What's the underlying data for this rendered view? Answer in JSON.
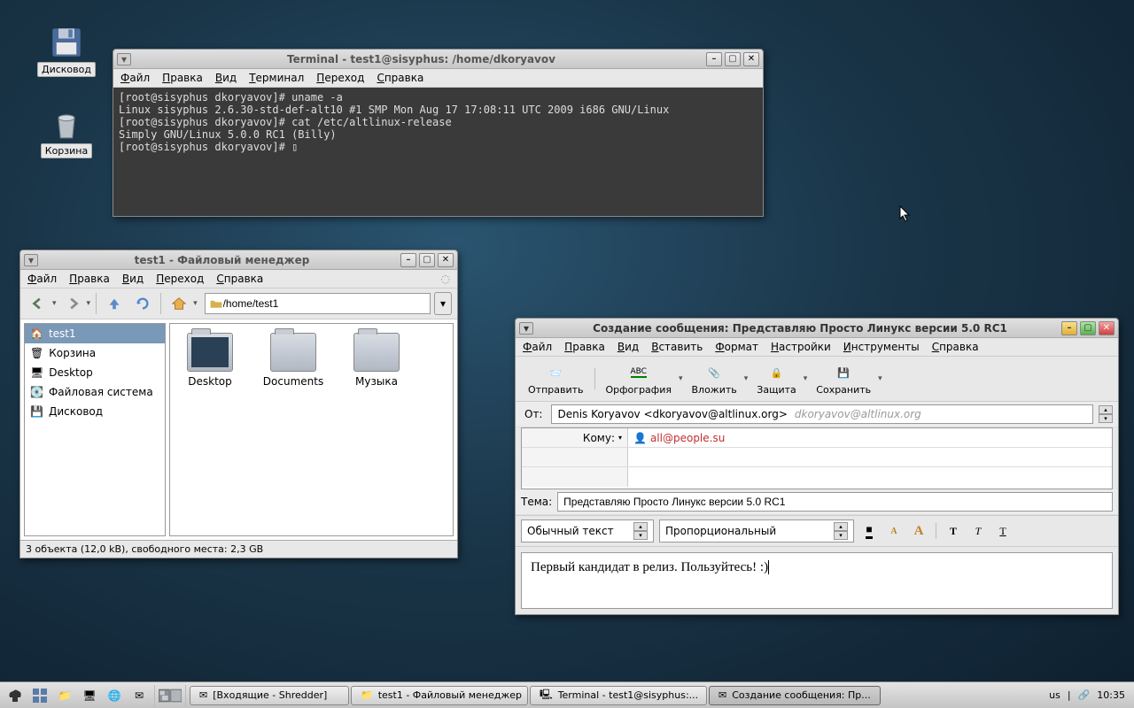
{
  "desktop": {
    "icons": [
      {
        "name": "floppy-icon",
        "label": "Дисковод"
      },
      {
        "name": "trash-icon",
        "label": "Корзина"
      }
    ]
  },
  "terminal": {
    "title": "Terminal - test1@sisyphus: /home/dkoryavov",
    "menu": [
      "Файл",
      "Правка",
      "Вид",
      "Терминал",
      "Переход",
      "Справка"
    ],
    "lines": "[root@sisyphus dkoryavov]# uname -a\nLinux sisyphus 2.6.30-std-def-alt10 #1 SMP Mon Aug 17 17:08:11 UTC 2009 i686 GNU/Linux\n[root@sisyphus dkoryavov]# cat /etc/altlinux-release\nSimply GNU/Linux 5.0.0 RC1 (Billy)\n[root@sisyphus dkoryavov]# ▯"
  },
  "fm": {
    "title": "test1 - Файловый менеджер",
    "menu": [
      "Файл",
      "Правка",
      "Вид",
      "Переход",
      "Справка"
    ],
    "path": "/home/test1",
    "sidebar": [
      {
        "label": "test1",
        "icon": "home",
        "selected": true
      },
      {
        "label": "Корзина",
        "icon": "trash"
      },
      {
        "label": "Desktop",
        "icon": "desktop"
      },
      {
        "label": "Файловая система",
        "icon": "disk"
      },
      {
        "label": "Дисковод",
        "icon": "floppy"
      }
    ],
    "folders": [
      {
        "label": "Desktop",
        "variant": "desktop-fld"
      },
      {
        "label": "Documents",
        "variant": ""
      },
      {
        "label": "Музыка",
        "variant": ""
      }
    ],
    "status": "3 объекта (12,0 kB), свободного места: 2,3 GB"
  },
  "compose": {
    "title": "Создание сообщения: Представляю Просто Линукс версии 5.0 RC1",
    "menu": [
      "Файл",
      "Правка",
      "Вид",
      "Вставить",
      "Формат",
      "Настройки",
      "Инструменты",
      "Справка"
    ],
    "toolbar": [
      {
        "label": "Отправить",
        "icon": "send"
      },
      {
        "label": "Орфография",
        "icon": "spell"
      },
      {
        "label": "Вложить",
        "icon": "attach"
      },
      {
        "label": "Защита",
        "icon": "lock"
      },
      {
        "label": "Сохранить",
        "icon": "save"
      }
    ],
    "from_label": "От:",
    "from_value": "Denis Koryavov <dkoryavov@altlinux.org>",
    "from_hint": "dkoryavov@altlinux.org",
    "to_label": "Кому:",
    "to_value": "all@people.su",
    "subject_label": "Тема:",
    "subject_value": "Представляю Просто Линукс версии 5.0 RC1",
    "format_text": "Обычный текст",
    "format_font": "Пропорциональный",
    "body": "Первый кандидат в релиз. Пользуйтесь! :)"
  },
  "taskbar": {
    "tasks": [
      {
        "label": "[Входящие - Shredder]",
        "icon": "mail",
        "active": false
      },
      {
        "label": "test1 - Файловый менеджер",
        "icon": "folder",
        "active": false
      },
      {
        "label": "Terminal - test1@sisyphus:...",
        "icon": "term",
        "active": false
      },
      {
        "label": "Создание сообщения: Пр...",
        "icon": "compose",
        "active": true
      }
    ],
    "lang": "us",
    "time": "10:35"
  }
}
